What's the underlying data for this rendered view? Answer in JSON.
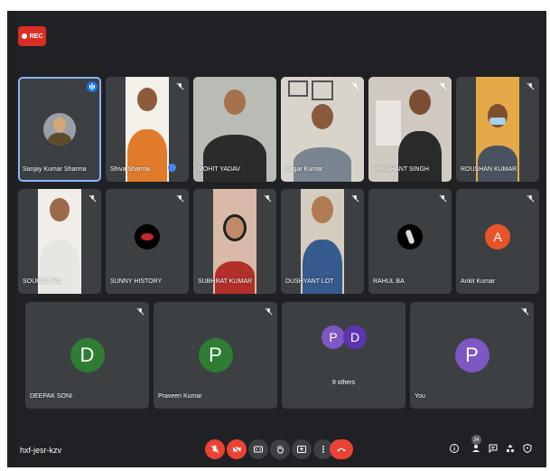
{
  "recording": {
    "label": "REC"
  },
  "meeting_code": "hxf-jesr-kzv",
  "participants_count": "24",
  "tiles": [
    {
      "name": "Sanjay Kumar Sharma"
    },
    {
      "name": "Shiva Sharma"
    },
    {
      "name": "MOHIT YADAV"
    },
    {
      "name": "Sagar Kumar"
    },
    {
      "name": "PRASHANT SINGH"
    },
    {
      "name": "ROUSHAN KUMAR"
    },
    {
      "name": "SOURAV PAL"
    },
    {
      "name": "SUNNY HISTORY"
    },
    {
      "name": "SUBHRAT KUMAR"
    },
    {
      "name": "DUSHYANT LOT"
    },
    {
      "name": "RAHUL BA"
    },
    {
      "name": "Ankit Kumar",
      "initial": "A",
      "color": "#e8542a"
    },
    {
      "name": "DEEPAK SONI",
      "initial": "D",
      "color": "#2e7d32"
    },
    {
      "name": "Praveen Kumar",
      "initial": "P",
      "color": "#2e7d32"
    },
    {
      "name": "9 others",
      "initials": [
        "P",
        "D"
      ],
      "colors": [
        "#7e57c2",
        "#5e35b1"
      ]
    },
    {
      "name": "You",
      "initial": "P",
      "color": "#7e57c2"
    }
  ],
  "colors": {
    "background": "#202124",
    "tile": "#3c4043",
    "danger": "#ea4335",
    "speaking": "#8ab4f8"
  },
  "controls": [
    "mic-off-icon",
    "camera-off-icon",
    "captions-icon",
    "raise-hand-icon",
    "present-icon",
    "more-options-icon",
    "end-call-icon"
  ],
  "right_controls": [
    "info-icon",
    "people-icon",
    "chat-icon",
    "activities-icon",
    "host-controls-icon"
  ]
}
